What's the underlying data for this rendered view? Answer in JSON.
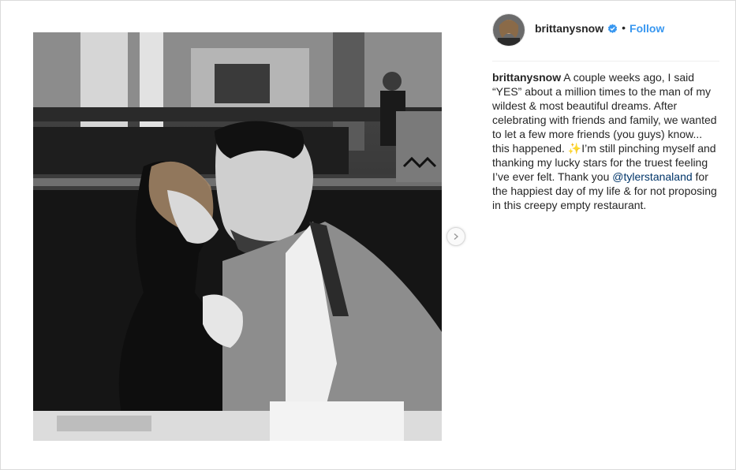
{
  "post": {
    "username": "brittanysnow",
    "follow_label": "Follow",
    "separator": "•",
    "caption": {
      "username": "brittanysnow",
      "text_before_emoji": "A couple weeks ago, I said “YES” about a million times to the man of my wildest & most beautiful dreams. After celebrating with friends and family, we wanted to let a few more friends (you guys) know... this happened.",
      "emoji": "✨",
      "text_after_emoji": "I’m still pinching myself and thanking my lucky stars for the truest feeling I’ve ever felt. Thank you",
      "mention": "@tylerstanaland",
      "text_end": "for the happiest day of my life & for not proposing in this creepy empty restaurant."
    }
  },
  "icons": {
    "verified": "verified-badge-icon",
    "next": "chevron-right-icon"
  },
  "colors": {
    "follow": "#3897f0",
    "verified": "#3897f0",
    "mention": "#003569",
    "text": "#262626",
    "border": "#dbdbdb"
  }
}
